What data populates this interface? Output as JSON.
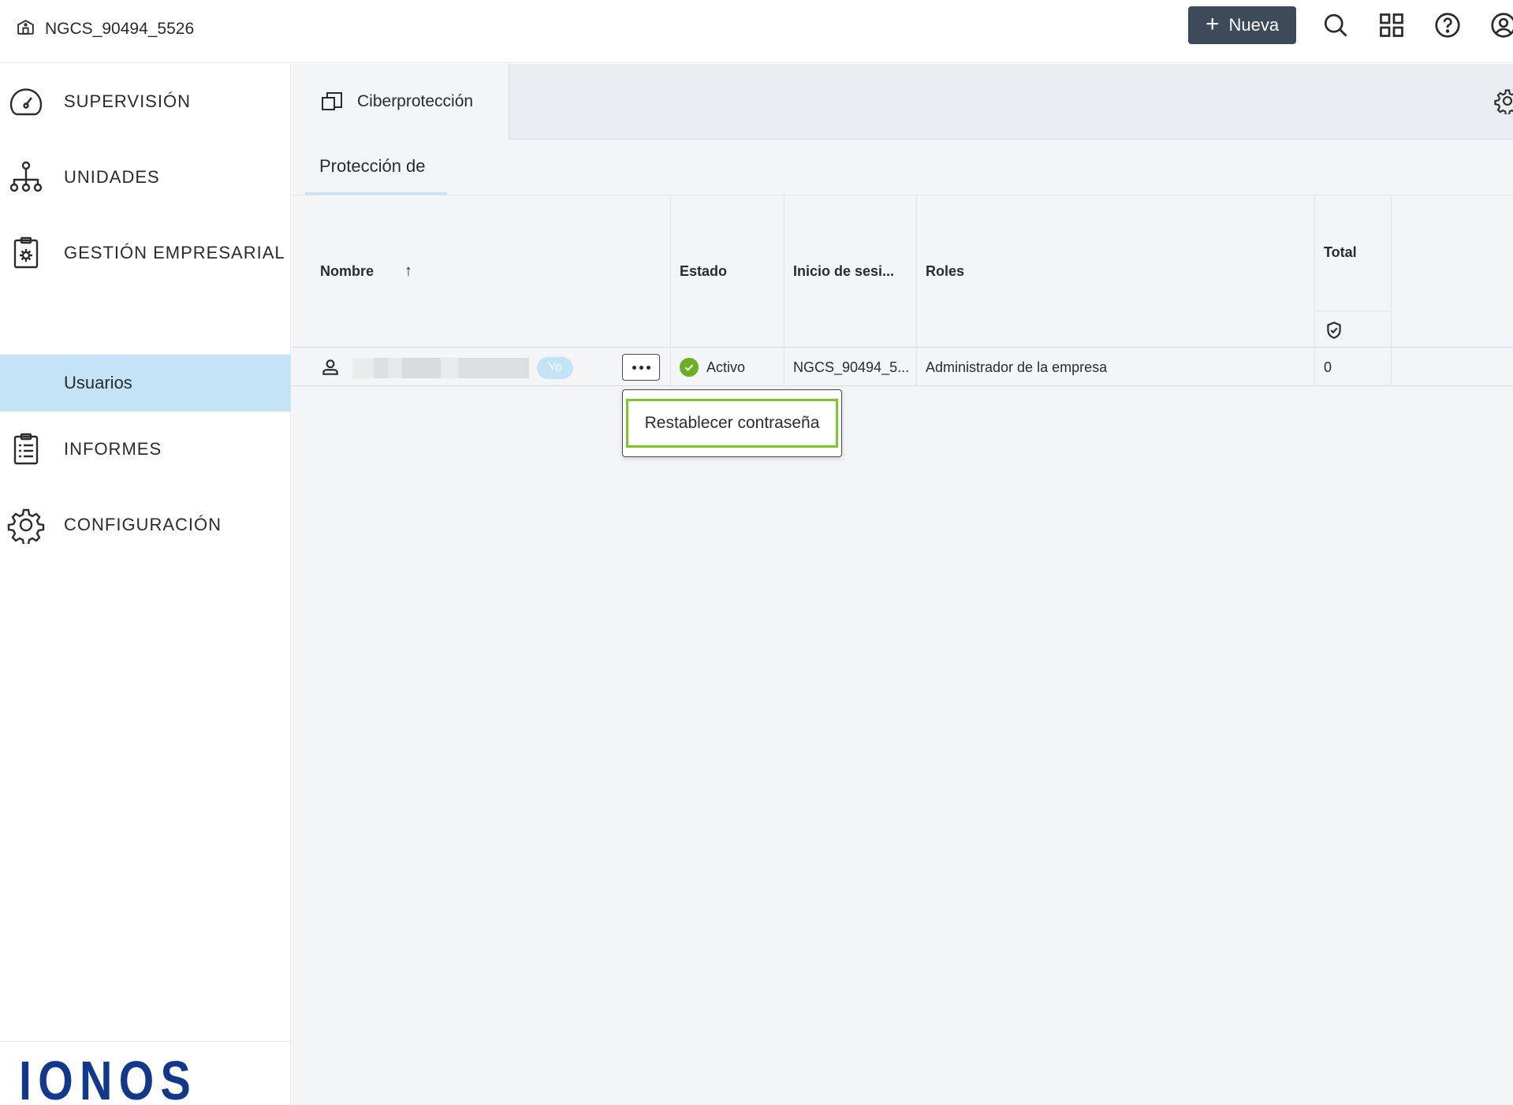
{
  "header": {
    "org_name": "NGCS_90494_5526",
    "new_button_label": "Nueva",
    "icons": [
      "search-icon",
      "apps-grid-icon",
      "help-icon",
      "account-icon"
    ]
  },
  "sidebar": {
    "items": [
      {
        "label": "SUPERVISIÓN",
        "icon": "speedometer-icon"
      },
      {
        "label": "UNIDADES",
        "icon": "hierarchy-icon"
      },
      {
        "label": "GESTIÓN EMPRESARIAL",
        "icon": "clipboard-gear-icon"
      },
      {
        "label": "Usuarios",
        "icon": null,
        "selected": true
      },
      {
        "label": "INFORMES",
        "icon": "report-icon"
      },
      {
        "label": "CONFIGURACIÓN",
        "icon": "gear-icon"
      }
    ],
    "logo_text": "IONOS"
  },
  "main": {
    "tab_label": "Ciberprotección",
    "subtab_label": "Protección de",
    "table": {
      "columns": {
        "name": "Nombre",
        "status": "Estado",
        "login": "Inicio de sesi...",
        "roles": "Roles",
        "total": "Total"
      },
      "rows": [
        {
          "badge": "Yo",
          "status": "Activo",
          "login": "NGCS_90494_5...",
          "roles": "Administrador de la empresa",
          "total": "0"
        }
      ]
    },
    "context_menu": {
      "items": [
        "Restablecer contraseña"
      ]
    }
  },
  "colors": {
    "accent": "#3d4a59",
    "selected_bg": "#c3e4f7",
    "highlight": "#7cc628",
    "status_ok": "#6ab023",
    "brand": "#11388c"
  }
}
